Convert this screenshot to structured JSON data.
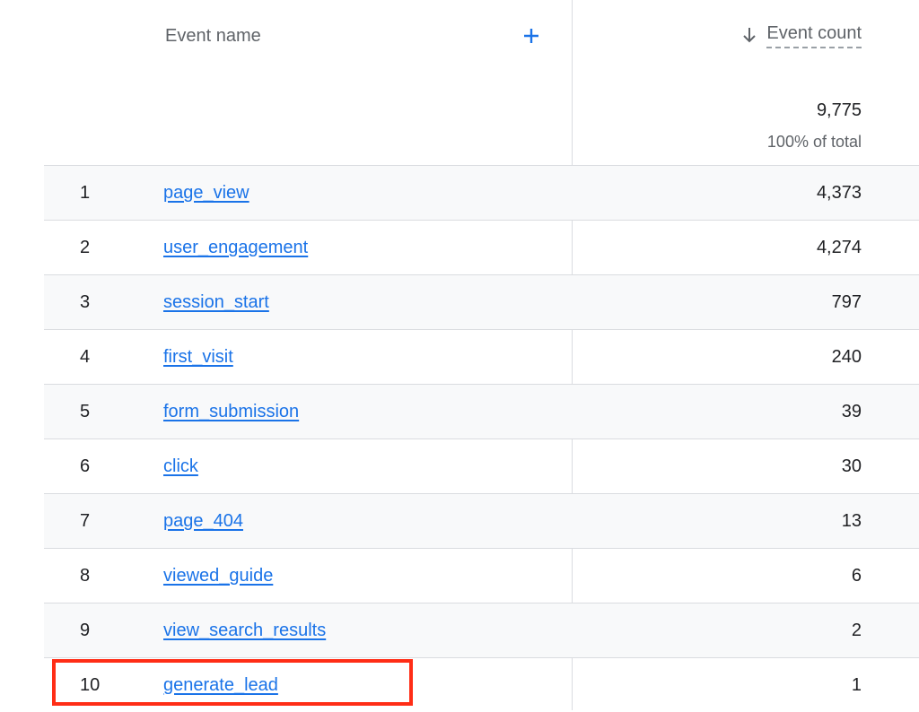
{
  "header": {
    "dimension_label": "Event name",
    "metric_label": "Event count",
    "add_icon": "plus-icon",
    "sort_icon": "arrow-down-icon"
  },
  "totals": {
    "value": "9,775",
    "percent": "100% of total"
  },
  "rows": [
    {
      "index": "1",
      "name": "page_view",
      "count": "4,373"
    },
    {
      "index": "2",
      "name": "user_engagement",
      "count": "4,274"
    },
    {
      "index": "3",
      "name": "session_start",
      "count": "797"
    },
    {
      "index": "4",
      "name": "first_visit",
      "count": "240"
    },
    {
      "index": "5",
      "name": "form_submission",
      "count": "39"
    },
    {
      "index": "6",
      "name": "click",
      "count": "30"
    },
    {
      "index": "7",
      "name": "page_404",
      "count": "13"
    },
    {
      "index": "8",
      "name": "viewed_guide",
      "count": "6"
    },
    {
      "index": "9",
      "name": "view_search_results",
      "count": "2"
    },
    {
      "index": "10",
      "name": "generate_lead",
      "count": "1"
    }
  ],
  "colors": {
    "link": "#1a73e8",
    "highlight": "#ff2d16",
    "row_shade": "#f8f9fa",
    "divider": "#dadce0"
  }
}
